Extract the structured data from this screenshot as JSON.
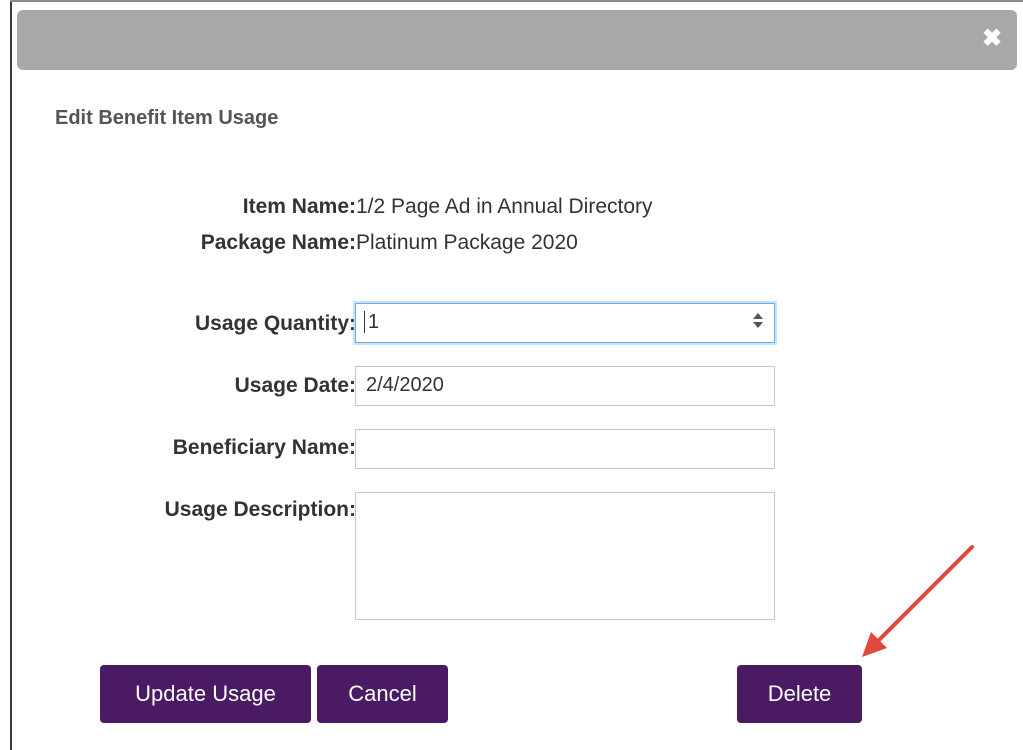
{
  "dialog": {
    "title": "Edit Benefit Item Usage",
    "close_glyph": "✖"
  },
  "info": {
    "item_name_label": "Item Name:",
    "item_name_value": "1/2 Page Ad in Annual Directory",
    "package_name_label": "Package Name:",
    "package_name_value": "Platinum Package 2020"
  },
  "form": {
    "usage_quantity_label": "Usage Quantity:",
    "usage_quantity_value": "1",
    "usage_date_label": "Usage Date:",
    "usage_date_value": "2/4/2020",
    "beneficiary_name_label": "Beneficiary Name:",
    "beneficiary_name_value": "",
    "usage_description_label": "Usage Description:",
    "usage_description_value": ""
  },
  "buttons": {
    "update_label": "Update Usage",
    "cancel_label": "Cancel",
    "delete_label": "Delete"
  },
  "colors": {
    "titlebar": "#a8a8a8",
    "button": "#4a1a63",
    "annotation_arrow": "#e0483e"
  },
  "icons": {
    "close": "close-icon",
    "stepper": "stepper-icon",
    "annotation": "arrow-annotation"
  }
}
